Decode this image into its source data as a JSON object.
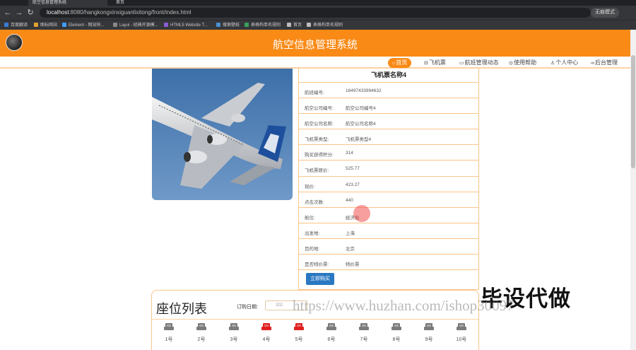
{
  "browser": {
    "tabs": [
      "航空信息管理系统",
      "首页"
    ],
    "url_host": "localhost",
    "url_rest": ":8080/hangkongxinxiguanlixitong/front/index.html",
    "profile_label": "无痕模式",
    "bookmarks": [
      "百度翻译",
      "图标网站",
      "Element - 网站快...",
      "Layui - 经典开源模...",
      "HTML5 Website T...",
      "搜索壁纸",
      "表格构单名规则",
      "首页",
      "表格构单名规则"
    ]
  },
  "site": {
    "title": "航空信息管理系统",
    "nav": [
      {
        "label": "首页",
        "icon": "home-icon"
      },
      {
        "label": "飞机票",
        "icon": "ticket-icon"
      },
      {
        "label": "航班管理动态",
        "icon": "list-icon"
      },
      {
        "label": "使用帮助",
        "icon": "help-icon"
      },
      {
        "label": "个人中心",
        "icon": "user-icon"
      },
      {
        "label": "后台管理",
        "icon": "link-icon"
      }
    ]
  },
  "product": {
    "name": "飞机票名称4",
    "fields": [
      {
        "label": "航班编号:",
        "value": "16497433994632"
      },
      {
        "label": "航空公司编号:",
        "value": "航空公司编号4"
      },
      {
        "label": "航空公司名称:",
        "value": "航空公司名称4"
      },
      {
        "label": "飞机票类型:",
        "value": "飞机票类型4"
      },
      {
        "label": "购买获得积分:",
        "value": "314"
      },
      {
        "label": "飞机票原价:",
        "value": "525.77"
      },
      {
        "label": "现价:",
        "value": "423.27"
      },
      {
        "label": "点击次数:",
        "value": "440"
      },
      {
        "label": "舱位:",
        "value": "经济舱"
      },
      {
        "label": "出发地:",
        "value": "上海"
      },
      {
        "label": "目的地:",
        "value": "北京"
      },
      {
        "label": "是否特价票:",
        "value": "特价票"
      }
    ],
    "buy_label": "立即购买"
  },
  "seats": {
    "title": "座位列表",
    "date_label": "订购日期:",
    "date_value": "202",
    "items": [
      {
        "label": "1号",
        "booked": false
      },
      {
        "label": "2号",
        "booked": false
      },
      {
        "label": "3号",
        "booked": false
      },
      {
        "label": "4号",
        "booked": true
      },
      {
        "label": "5号",
        "booked": true
      },
      {
        "label": "6号",
        "booked": false
      },
      {
        "label": "7号",
        "booked": false
      },
      {
        "label": "8号",
        "booked": false
      },
      {
        "label": "9号",
        "booked": false
      },
      {
        "label": "10号",
        "booked": false
      }
    ],
    "colors": {
      "free": "#7b7b7b",
      "booked": "#e02020"
    }
  },
  "watermark": {
    "big": "毕设代做",
    "url": "https://www.huzhan.com/ishop30097"
  },
  "colors": {
    "accent": "#fa8a16",
    "button": "#2a78c2"
  }
}
